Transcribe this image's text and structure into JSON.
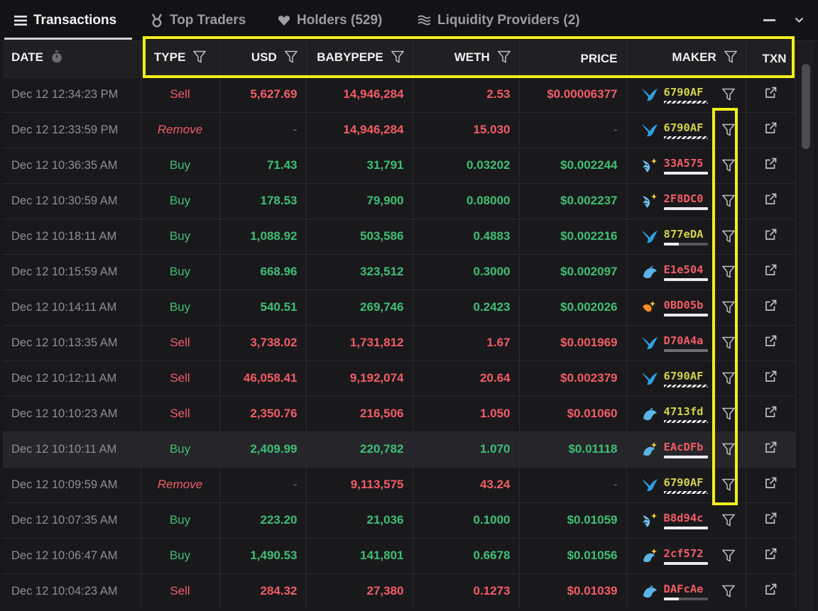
{
  "tabs": [
    {
      "label": "Transactions",
      "icon": "list-icon"
    },
    {
      "label": "Top Traders",
      "icon": "medal-icon"
    },
    {
      "label": "Holders (529)",
      "icon": "heart-icon"
    },
    {
      "label": "Liquidity Providers (2)",
      "icon": "waves-icon"
    }
  ],
  "window_controls": {
    "minimize": "minus-icon",
    "collapse": "chevron-down-icon"
  },
  "table": {
    "columns": [
      "DATE",
      "TYPE",
      "USD",
      "BABYPEPE",
      "WETH",
      "PRICE",
      "MAKER",
      "TXN"
    ],
    "rows": [
      {
        "date": "Dec 12 12:34:23 PM",
        "type": "Sell",
        "usd": "5,627.69",
        "babypepe": "14,946,284",
        "weth": "2.53",
        "price": "$0.00006377",
        "maker": "6790AF",
        "maker_color": "#d6d04a",
        "icon": "shark",
        "bar": "hatched"
      },
      {
        "date": "Dec 12 12:33:59 PM",
        "type": "Remove",
        "usd": "-",
        "babypepe": "14,946,284",
        "weth": "15.030",
        "price": "-",
        "maker": "6790AF",
        "maker_color": "#d6d04a",
        "icon": "shark",
        "bar": "hatched"
      },
      {
        "date": "Dec 12 10:36:35 AM",
        "type": "Buy",
        "usd": "71.43",
        "babypepe": "31,791",
        "weth": "0.03202",
        "price": "$0.002244",
        "maker": "33A575",
        "maker_color": "#f25c66",
        "icon": "shrimp-new",
        "bar": "white"
      },
      {
        "date": "Dec 12 10:30:59 AM",
        "type": "Buy",
        "usd": "178.53",
        "babypepe": "79,900",
        "weth": "0.08000",
        "price": "$0.002237",
        "maker": "2F8DC0",
        "maker_color": "#f25c66",
        "icon": "shrimp-new",
        "bar": "white"
      },
      {
        "date": "Dec 12 10:18:11 AM",
        "type": "Buy",
        "usd": "1,088.92",
        "babypepe": "503,586",
        "weth": "0.4883",
        "price": "$0.002216",
        "maker": "877eDA",
        "maker_color": "#d6d04a",
        "icon": "shark",
        "bar": "partial"
      },
      {
        "date": "Dec 12 10:15:59 AM",
        "type": "Buy",
        "usd": "668.96",
        "babypepe": "323,512",
        "weth": "0.3000",
        "price": "$0.002097",
        "maker": "E1e504",
        "maker_color": "#f25c66",
        "icon": "fish",
        "bar": "white"
      },
      {
        "date": "Dec 12 10:14:11 AM",
        "type": "Buy",
        "usd": "540.51",
        "babypepe": "269,746",
        "weth": "0.2423",
        "price": "$0.002026",
        "maker": "0BD05b",
        "maker_color": "#f25c66",
        "icon": "fish-orange",
        "bar": "white"
      },
      {
        "date": "Dec 12 10:13:35 AM",
        "type": "Sell",
        "usd": "3,738.02",
        "babypepe": "1,731,812",
        "weth": "1.67",
        "price": "$0.001969",
        "maker": "D70A4a",
        "maker_color": "#f25c66",
        "icon": "shark",
        "bar": "gray"
      },
      {
        "date": "Dec 12 10:12:11 AM",
        "type": "Sell",
        "usd": "46,058.41",
        "babypepe": "9,192,074",
        "weth": "20.64",
        "price": "$0.002379",
        "maker": "6790AF",
        "maker_color": "#d6d04a",
        "icon": "shark",
        "bar": "hatched"
      },
      {
        "date": "Dec 12 10:10:23 AM",
        "type": "Sell",
        "usd": "2,350.76",
        "babypepe": "216,506",
        "weth": "1.050",
        "price": "$0.01060",
        "maker": "4713fd",
        "maker_color": "#d6d04a",
        "icon": "fish",
        "bar": "hatched"
      },
      {
        "date": "Dec 12 10:10:11 AM",
        "type": "Buy",
        "usd": "2,409.99",
        "babypepe": "220,782",
        "weth": "1.070",
        "price": "$0.01118",
        "maker": "EAcDFb",
        "maker_color": "#f25c66",
        "icon": "fish-new",
        "bar": "white"
      },
      {
        "date": "Dec 12 10:09:59 AM",
        "type": "Remove",
        "usd": "-",
        "babypepe": "9,113,575",
        "weth": "43.24",
        "price": "-",
        "maker": "6790AF",
        "maker_color": "#d6d04a",
        "icon": "shark",
        "bar": "hatched"
      },
      {
        "date": "Dec 12 10:07:35 AM",
        "type": "Buy",
        "usd": "223.20",
        "babypepe": "21,036",
        "weth": "0.1000",
        "price": "$0.01059",
        "maker": "B8d94c",
        "maker_color": "#f25c66",
        "icon": "shrimp-new",
        "bar": "white"
      },
      {
        "date": "Dec 12 10:06:47 AM",
        "type": "Buy",
        "usd": "1,490.53",
        "babypepe": "141,801",
        "weth": "0.6678",
        "price": "$0.01056",
        "maker": "2cf572",
        "maker_color": "#f25c66",
        "icon": "fish-new",
        "bar": "white"
      },
      {
        "date": "Dec 12 10:04:23 AM",
        "type": "Sell",
        "usd": "284.32",
        "babypepe": "27,380",
        "weth": "0.1273",
        "price": "$0.01039",
        "maker": "DAFcAe",
        "maker_color": "#f25c66",
        "icon": "fish",
        "bar": "partial"
      }
    ]
  },
  "colors": {
    "sell": "#f25c66",
    "buy": "#3fbf74",
    "highlight": "#f2ef1b",
    "background": "#18181b"
  }
}
